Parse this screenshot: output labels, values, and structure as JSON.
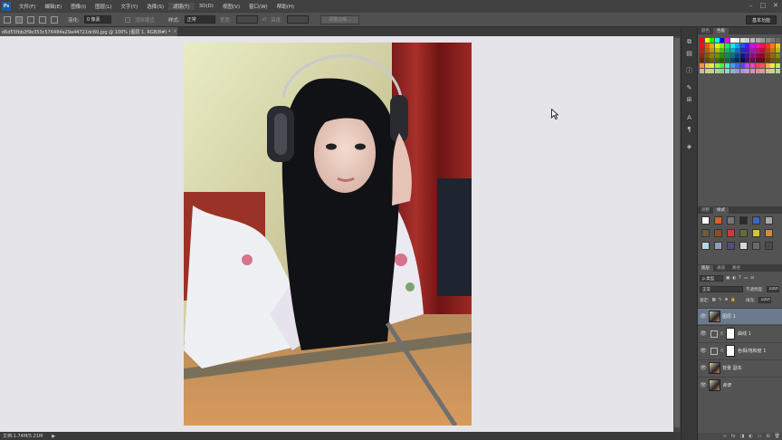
{
  "menu": {
    "logo": "Ps",
    "items": [
      "文件(F)",
      "编辑(E)",
      "图像(I)",
      "图层(L)",
      "文字(Y)",
      "选择(S)",
      "滤镜(T)",
      "3D(D)",
      "视图(V)",
      "窗口(W)",
      "帮助(H)"
    ],
    "active_index": 6,
    "window_buttons": [
      "–",
      "□",
      "✕"
    ]
  },
  "options": {
    "feather_label": "羽化:",
    "feather_value": "0 像素",
    "antialias_label": "消除锯齿",
    "style_label": "样式:",
    "style_value": "正常",
    "width_label": "宽度:",
    "height_label": "高度:",
    "refine_button": "调整边缘...",
    "workspace": "基本功能"
  },
  "document": {
    "tab_title": "d6d55fbb2f9e353c576484a29a44721dc60.jpg @ 100% (图层 1, RGB/8#) *",
    "close": "×"
  },
  "status": {
    "doc_info": "文档:1.74M/5.21M",
    "arrow": "▶"
  },
  "swatches_panel": {
    "tabs": [
      "颜色",
      "色板"
    ],
    "active_tab": 1
  },
  "styles_panel": {
    "tabs": [
      "调整",
      "样式"
    ],
    "active_tab": 1
  },
  "layers_panel": {
    "tabs": [
      "图层",
      "通道",
      "路径"
    ],
    "active_tab": 0,
    "kind_label": "ρ 类型",
    "blend_mode": "正常",
    "opacity_label": "不透明度:",
    "opacity_value": "100%",
    "lock_label": "锁定:",
    "fill_label": "填充:",
    "fill_value": "100%",
    "eye": "👁",
    "chain": "8",
    "layers": [
      {
        "name": "图层 1",
        "kind": "pixel",
        "selected": true
      },
      {
        "name": "曲线 1",
        "kind": "adjustment",
        "selected": false
      },
      {
        "name": "色相/饱和度 1",
        "kind": "adjustment",
        "selected": false
      },
      {
        "name": "背景 副本",
        "kind": "pixel",
        "selected": false
      },
      {
        "name": "背景",
        "kind": "pixel",
        "selected": false
      }
    ],
    "footer_icons": [
      "∞",
      "fx",
      "◨",
      "◐",
      "▭",
      "⊞",
      "🗑"
    ]
  },
  "colors": {
    "menubar": "#414141",
    "canvas_bg": "#e5e4e9",
    "selected_layer": "#6c7a8e"
  }
}
